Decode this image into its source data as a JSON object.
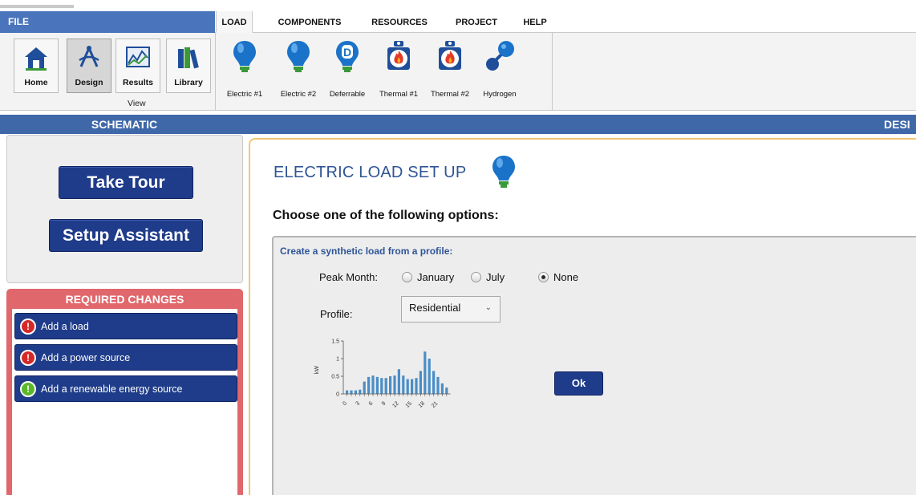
{
  "menu": {
    "file_label": "FILE",
    "tabs": [
      {
        "label": "LOAD",
        "active": true
      },
      {
        "label": "COMPONENTS",
        "active": false
      },
      {
        "label": "RESOURCES",
        "active": false
      },
      {
        "label": "PROJECT",
        "active": false
      },
      {
        "label": "HELP",
        "active": false
      }
    ]
  },
  "ribbon": {
    "view_group_label": "View",
    "view_buttons": [
      {
        "label": "Home",
        "icon": "home-icon",
        "selected": false
      },
      {
        "label": "Design",
        "icon": "design-compass-icon",
        "selected": true
      },
      {
        "label": "Results",
        "icon": "results-chart-icon",
        "selected": false
      },
      {
        "label": "Library",
        "icon": "library-books-icon",
        "selected": false
      }
    ],
    "load_buttons": [
      {
        "label": "Electric #1",
        "icon": "lightbulb-icon"
      },
      {
        "label": "Electric #2",
        "icon": "lightbulb-icon"
      },
      {
        "label": "Deferrable",
        "icon": "deferrable-bulb-icon"
      },
      {
        "label": "Thermal #1",
        "icon": "thermal-flame-icon"
      },
      {
        "label": "Thermal #2",
        "icon": "thermal-flame-icon"
      },
      {
        "label": "Hydrogen",
        "icon": "hydrogen-molecule-icon"
      }
    ]
  },
  "sections": {
    "schematic_title": "SCHEMATIC",
    "design_title": "DESI"
  },
  "left": {
    "take_tour_label": "Take Tour",
    "setup_assistant_label": "Setup Assistant",
    "required_changes_title": "REQUIRED CHANGES",
    "required_changes": [
      {
        "label": "Add a load",
        "status": "error"
      },
      {
        "label": "Add a power source",
        "status": "error"
      },
      {
        "label": "Add a renewable energy source",
        "status": "ok"
      }
    ]
  },
  "main": {
    "title": "ELECTRIC LOAD SET UP",
    "subtitle": "Choose one of the following options:",
    "synthetic_heading": "Create a synthetic load from a profile:",
    "peak_month_label": "Peak Month:",
    "peak_month_options": [
      {
        "label": "January",
        "selected": false
      },
      {
        "label": "July",
        "selected": false
      },
      {
        "label": "None",
        "selected": true
      }
    ],
    "profile_label": "Profile:",
    "profile_value": "Residential",
    "ok_label": "Ok"
  },
  "colors": {
    "brand_blue": "#3f68a8",
    "button_navy": "#1f3c8a",
    "required_red": "#e0676b",
    "title_blue": "#2f5597",
    "bar_blue": "#4a8ec7"
  },
  "chart_data": {
    "type": "bar",
    "ylabel": "kW",
    "xlabel": "",
    "ylim": [
      0,
      1.5
    ],
    "yticks": [
      "0",
      "0.5",
      "1",
      "1.5"
    ],
    "xticks": [
      "0",
      "3",
      "6",
      "9",
      "12",
      "15",
      "18",
      "21"
    ],
    "categories": [
      0,
      1,
      2,
      3,
      4,
      5,
      6,
      7,
      8,
      9,
      10,
      11,
      12,
      13,
      14,
      15,
      16,
      17,
      18,
      19,
      20,
      21,
      22,
      23
    ],
    "values": [
      0.1,
      0.1,
      0.1,
      0.12,
      0.35,
      0.48,
      0.52,
      0.48,
      0.45,
      0.45,
      0.5,
      0.52,
      0.7,
      0.52,
      0.42,
      0.42,
      0.45,
      0.65,
      1.2,
      1.0,
      0.65,
      0.48,
      0.3,
      0.18
    ]
  }
}
